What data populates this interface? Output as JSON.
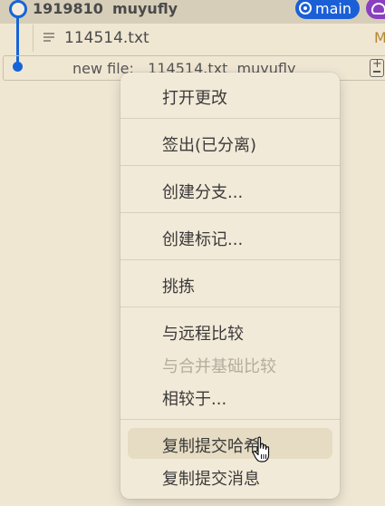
{
  "commit": {
    "hash": "1919810",
    "author": "muyufly",
    "branch": "main"
  },
  "file": {
    "name": "114514.txt",
    "status": "M"
  },
  "input": {
    "text": "new file:   114514.txt  muyufly"
  },
  "menu": {
    "open_changes": "打开更改",
    "checkout_detached": "签出(已分离)",
    "create_branch": "创建分支...",
    "create_tag": "创建标记...",
    "cherry_pick": "挑拣",
    "compare_remote": "与远程比较",
    "compare_merge_base": "与合并基础比较",
    "compare_with": "相较于...",
    "copy_hash": "复制提交哈希",
    "copy_message": "复制提交消息"
  },
  "colors": {
    "accent": "#1665d8",
    "branch_badge": "#1b5fd6",
    "remote_badge": "#8b3fbf",
    "modified": "#b7852f"
  }
}
